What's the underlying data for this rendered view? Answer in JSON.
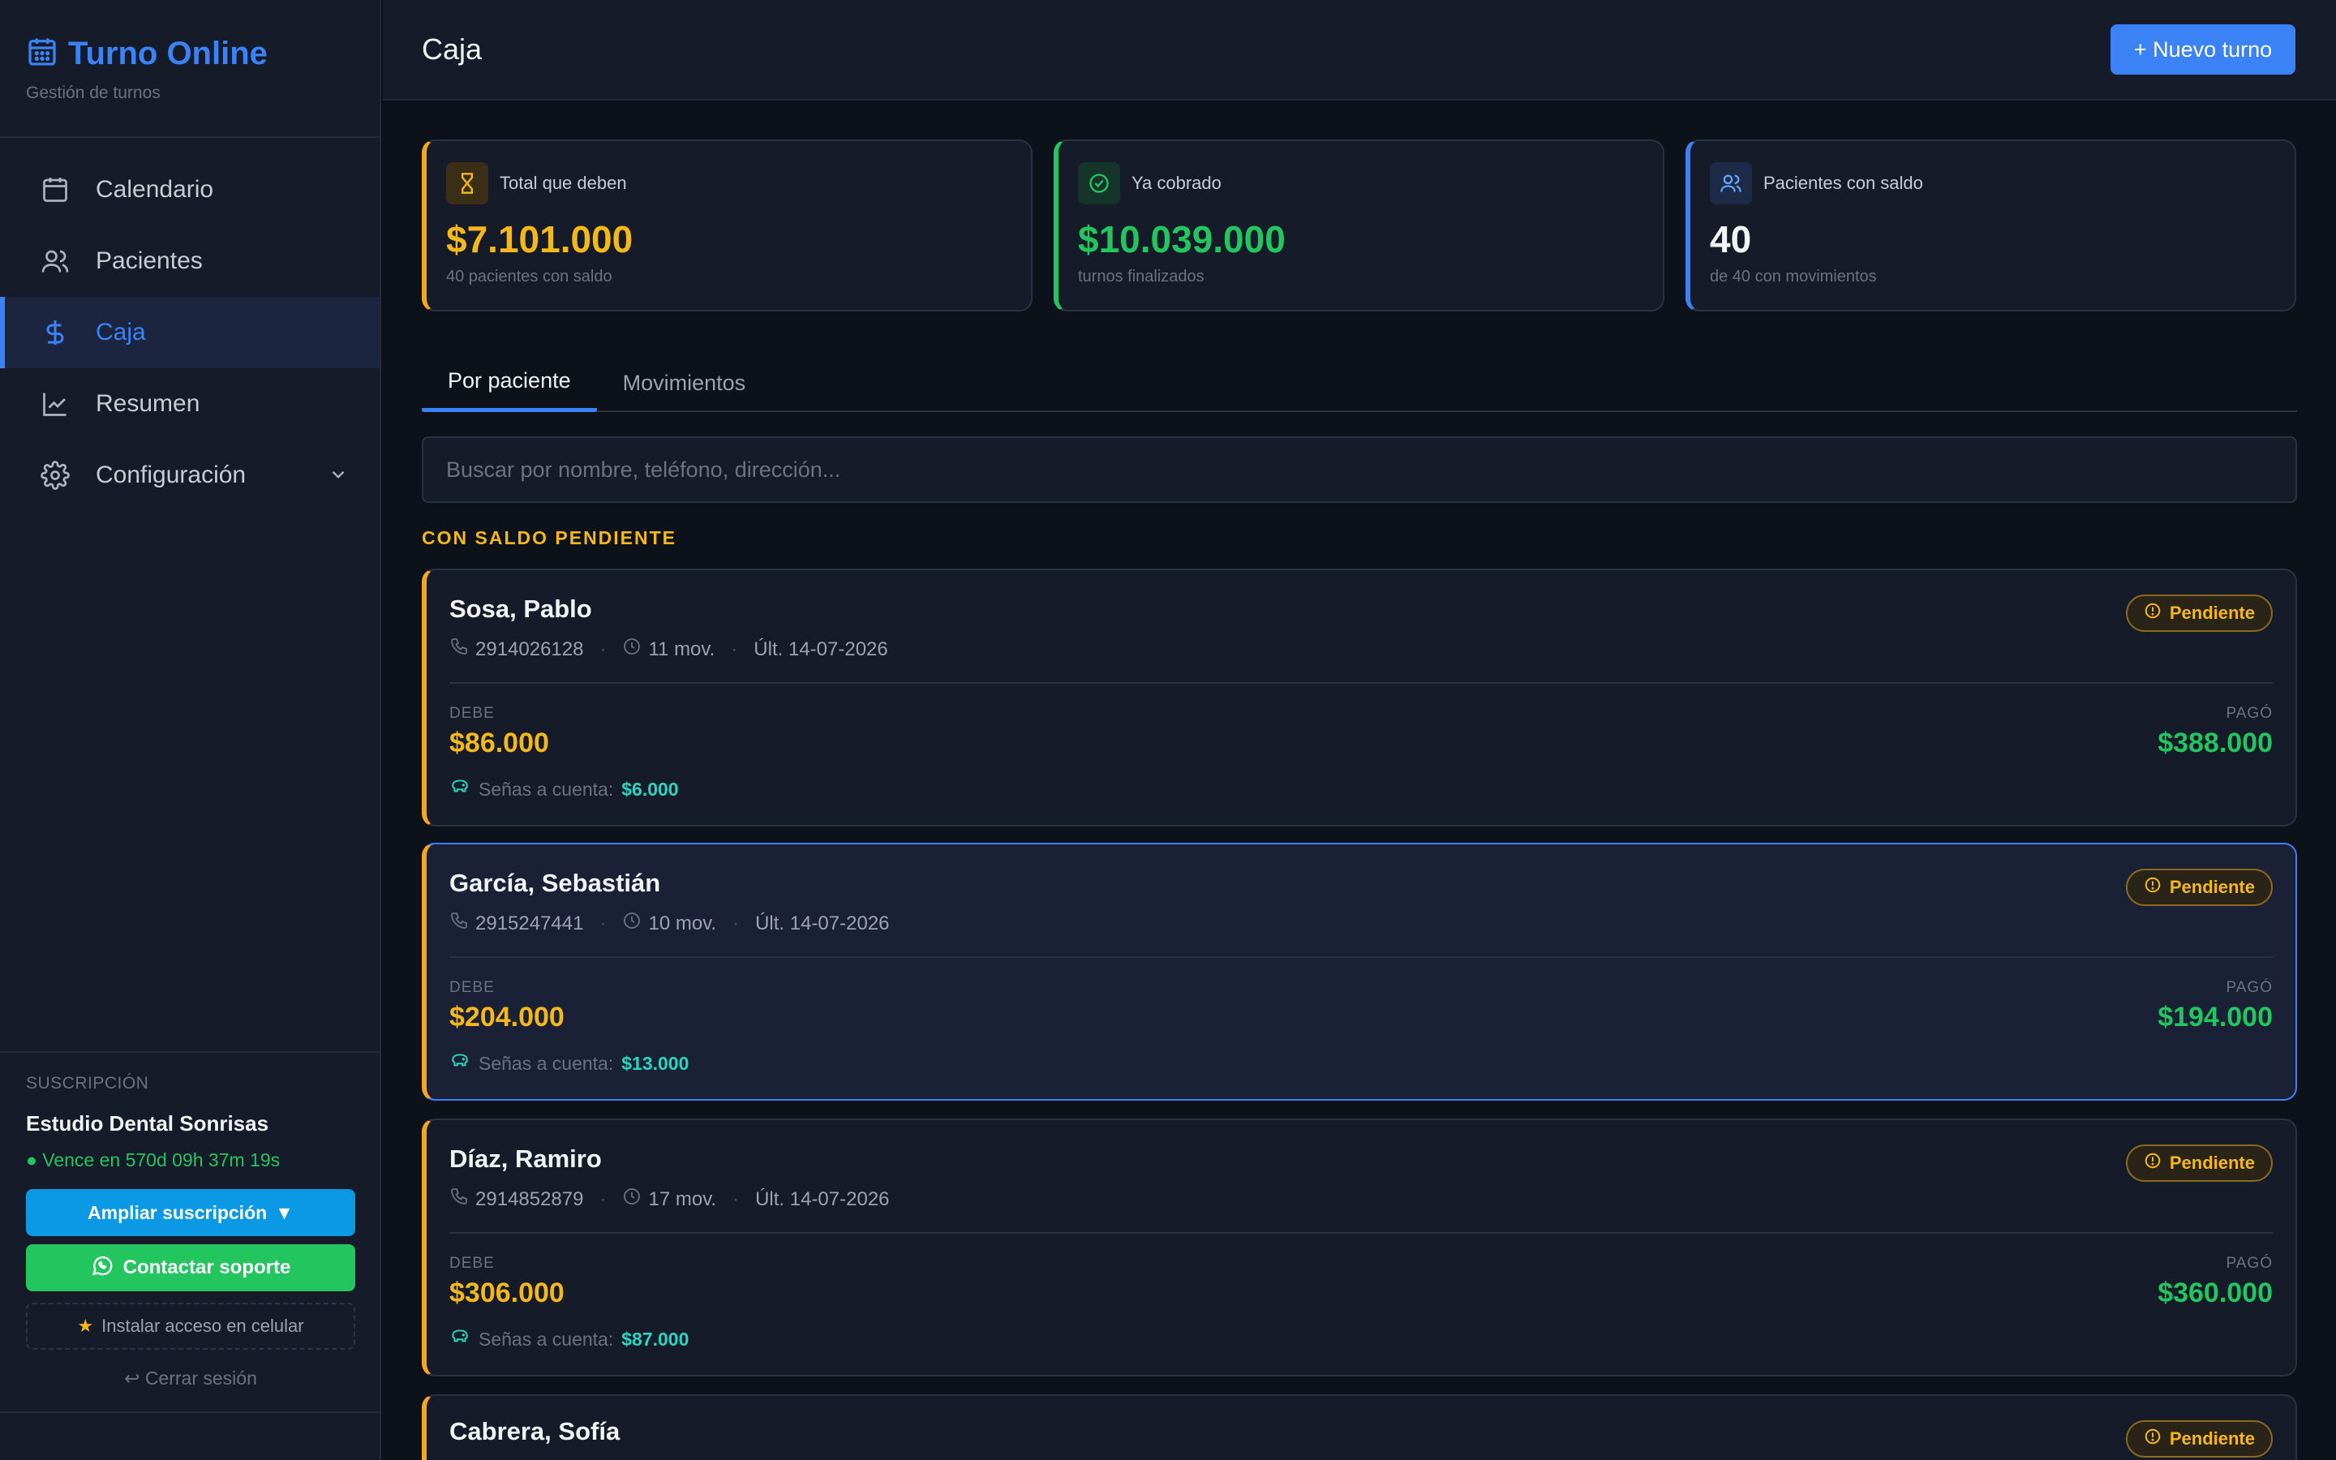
{
  "brand": {
    "title": "Turno Online",
    "subtitle": "Gestión de turnos"
  },
  "nav": {
    "items": [
      {
        "label": "Calendario",
        "icon": "calendar-icon"
      },
      {
        "label": "Pacientes",
        "icon": "users-icon"
      },
      {
        "label": "Caja",
        "icon": "dollar-icon",
        "active": true
      },
      {
        "label": "Resumen",
        "icon": "chart-line-icon"
      },
      {
        "label": "Configuración",
        "icon": "gear-icon"
      }
    ]
  },
  "subscription": {
    "label": "SUSCRIPCIÓN",
    "name": "Estudio Dental Sonrisas",
    "expires": "● Vence en 570d 09h 37m 19s",
    "extend_label": "Ampliar suscripción",
    "support_label": "Contactar soporte",
    "install_label": "Instalar acceso en celular",
    "logout_label": "Cerrar sesión"
  },
  "header": {
    "title": "Caja",
    "new_button": "+ Nuevo turno"
  },
  "stats": [
    {
      "label": "Total que deben",
      "value": "$7.101.000",
      "sub": "40 pacientes con saldo",
      "color": "#f5b81a"
    },
    {
      "label": "Ya cobrado",
      "value": "$10.039.000",
      "sub": "turnos finalizados",
      "color": "#22c55e"
    },
    {
      "label": "Pacientes con saldo",
      "value": "40",
      "sub": "de 40 con movimientos",
      "color": "#3b82f6"
    }
  ],
  "tabs": [
    {
      "label": "Por paciente",
      "active": true
    },
    {
      "label": "Movimientos"
    }
  ],
  "search": {
    "placeholder": "Buscar por nombre, teléfono, dirección..."
  },
  "section_title": "CON SALDO PENDIENTE",
  "labels": {
    "debe": "DEBE",
    "pago": "PAGÓ",
    "senas": "Señas a cuenta:",
    "status": "Pendiente"
  },
  "patients": [
    {
      "name": "Sosa, Pablo",
      "phone": "2914026128",
      "movements": "11 mov.",
      "last": "Últ. 14-07-2026",
      "debe": "$86.000",
      "pago": "$388.000",
      "senas": "$6.000"
    },
    {
      "name": "García, Sebastián",
      "phone": "2915247441",
      "movements": "10 mov.",
      "last": "Últ. 14-07-2026",
      "debe": "$204.000",
      "pago": "$194.000",
      "senas": "$13.000"
    },
    {
      "name": "Díaz, Ramiro",
      "phone": "2914852879",
      "movements": "17 mov.",
      "last": "Últ. 14-07-2026",
      "debe": "$306.000",
      "pago": "$360.000",
      "senas": "$87.000"
    },
    {
      "name": "Cabrera, Sofía"
    }
  ]
}
